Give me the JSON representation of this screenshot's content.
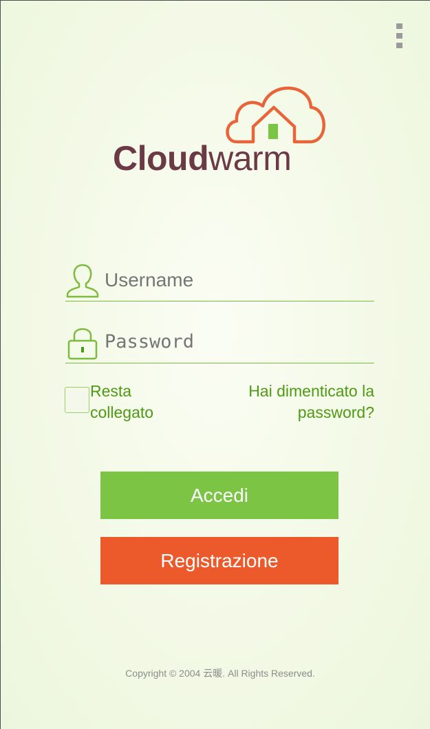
{
  "menu": {
    "icon": "overflow-menu-icon"
  },
  "logo": {
    "brand_bold": "Cloud",
    "brand_light": "warm",
    "icon": "cloud-house-icon",
    "colors": {
      "cloud": "#e8653a",
      "house_door": "#7cc443",
      "text": "#6b3a46"
    }
  },
  "login": {
    "username_placeholder": "Username",
    "password_placeholder": "Password",
    "username_icon": "user-icon",
    "password_icon": "lock-icon",
    "remember_label": "Resta collegato",
    "remember_checked": false,
    "forgot_label": "Hai dimenticato la password?",
    "login_button": "Accedi",
    "register_button": "Registrazione"
  },
  "colors": {
    "accent_green": "#7cc443",
    "accent_orange": "#ec5a2c",
    "link_green": "#4e9a15"
  },
  "footer": {
    "copyright": "Copyright © 2004 云暖. All Rights Reserved."
  }
}
